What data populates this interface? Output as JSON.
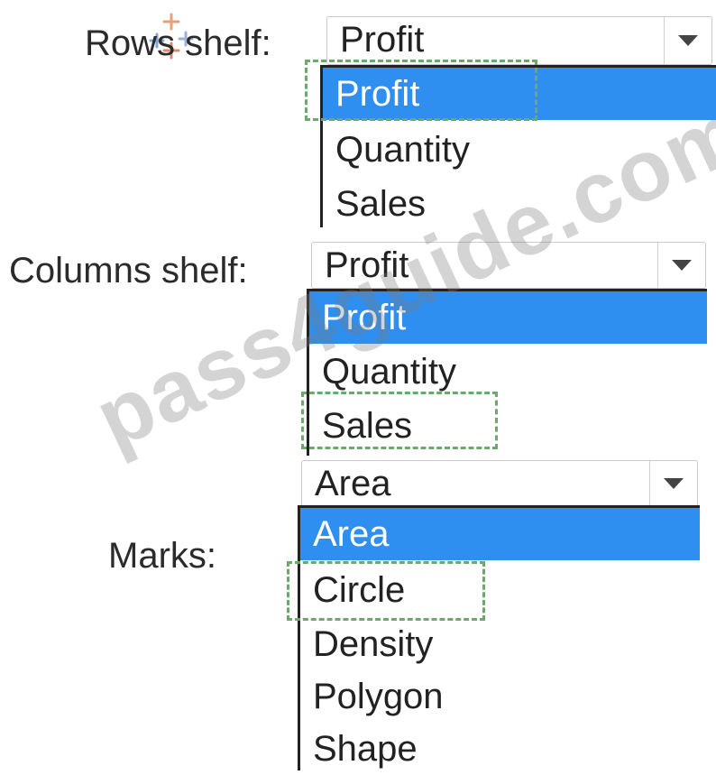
{
  "rows": {
    "label": "Rows shelf:",
    "selected": "Profit",
    "options": [
      "Profit",
      "Quantity",
      "Sales"
    ]
  },
  "columns": {
    "label": "Columns shelf:",
    "selected": "Profit",
    "options": [
      "Profit",
      "Quantity",
      "Sales"
    ]
  },
  "marks": {
    "label": "Marks:",
    "selected": "Area",
    "options": [
      "Area",
      "Circle",
      "Density",
      "Polygon",
      "Shape"
    ]
  },
  "watermark": "pass4guide.com",
  "colors": {
    "highlight": "#2f8ff0",
    "dashed_box": "#6aaa6a"
  },
  "icons": {
    "dropdown": "chevron-down-icon",
    "logo": "tableau-logo-icon"
  }
}
